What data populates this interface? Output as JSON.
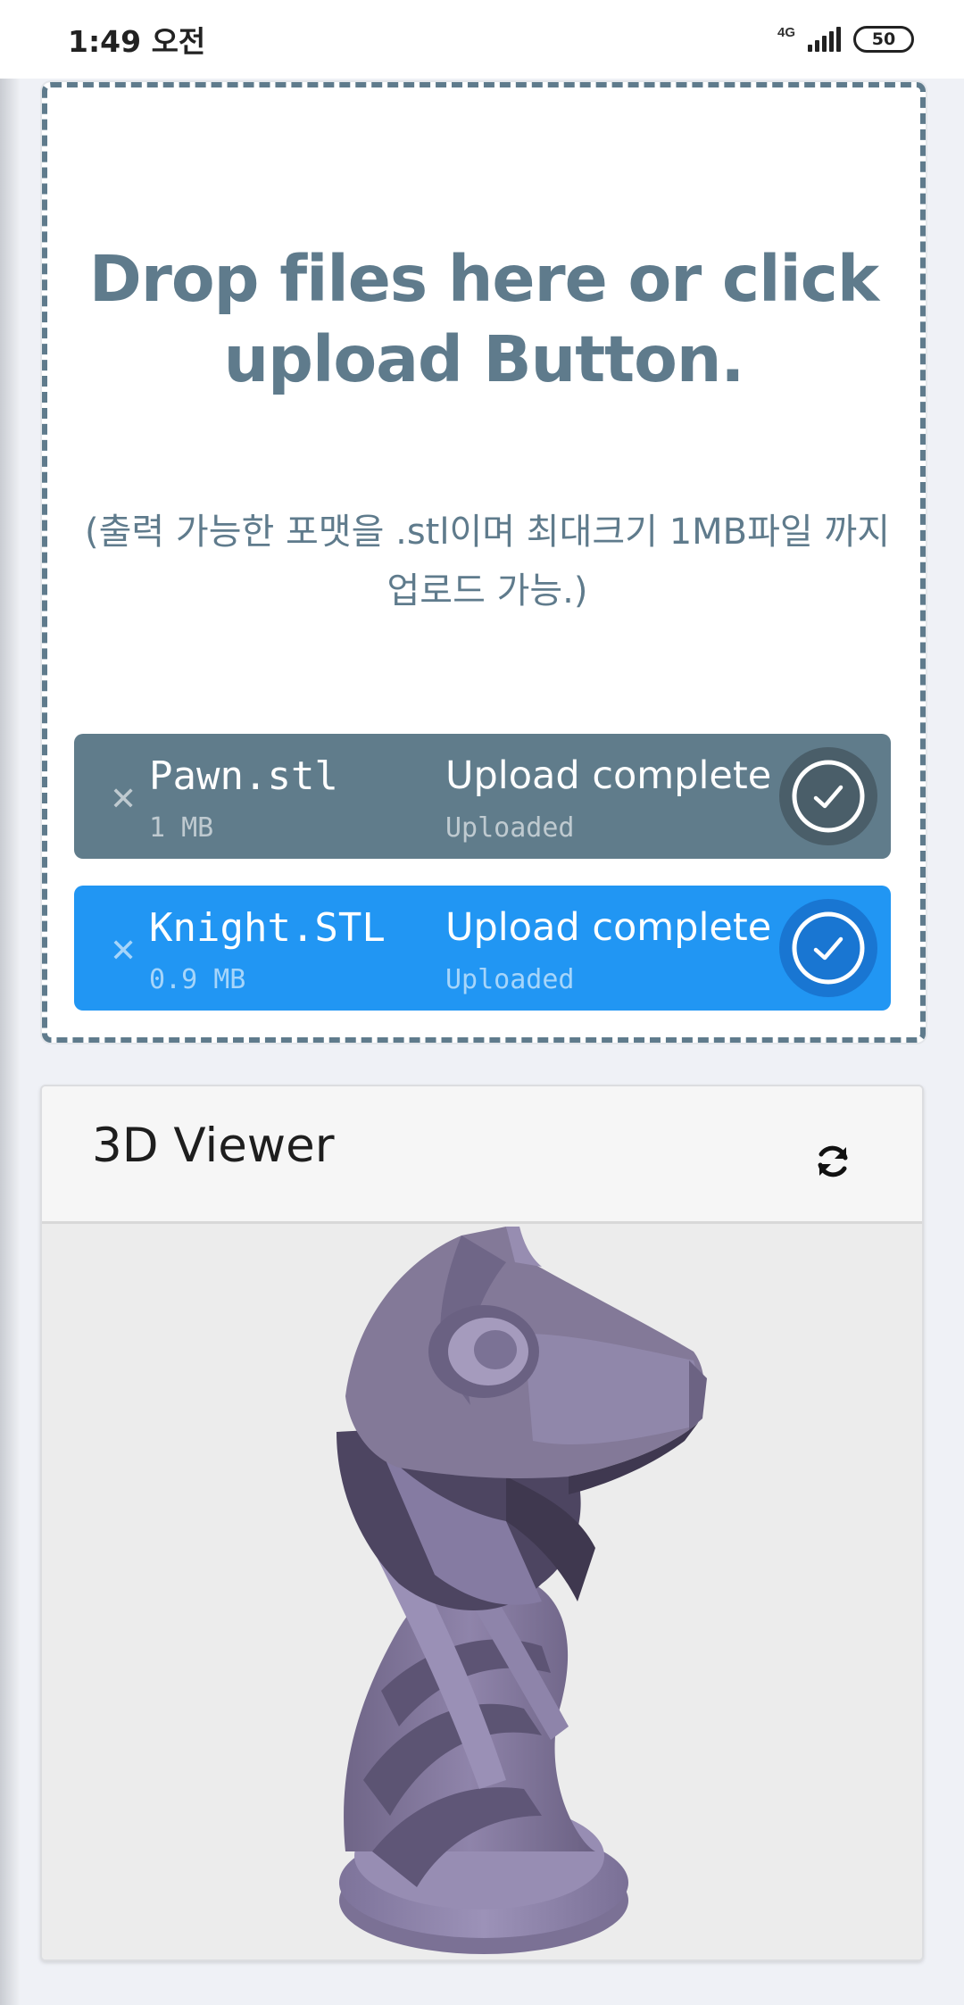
{
  "status_bar": {
    "time": "1:49 오전",
    "network": "4G",
    "battery": "50",
    "icons": [
      "signal-icon",
      "battery-icon"
    ]
  },
  "upload": {
    "title": "Drop files here or click upload Button.",
    "subtitle": "(출력 가능한 포맷을 .stl이며 최대크기 1MB파일 까지 업로드 가능.)",
    "files": [
      {
        "name": "Pawn.stl",
        "size": "1 MB",
        "status": "Upload complete",
        "substatus": "Uploaded",
        "color": "#607c8b"
      },
      {
        "name": "Knight.STL",
        "size": "0.9 MB",
        "status": "Upload complete",
        "substatus": "Uploaded",
        "color": "#2196f3"
      }
    ],
    "border_color": "#5f7b8c"
  },
  "viewer": {
    "title": "3D Viewer",
    "refresh_icon": "refresh-icon",
    "model_color": "#8a7fa3"
  }
}
